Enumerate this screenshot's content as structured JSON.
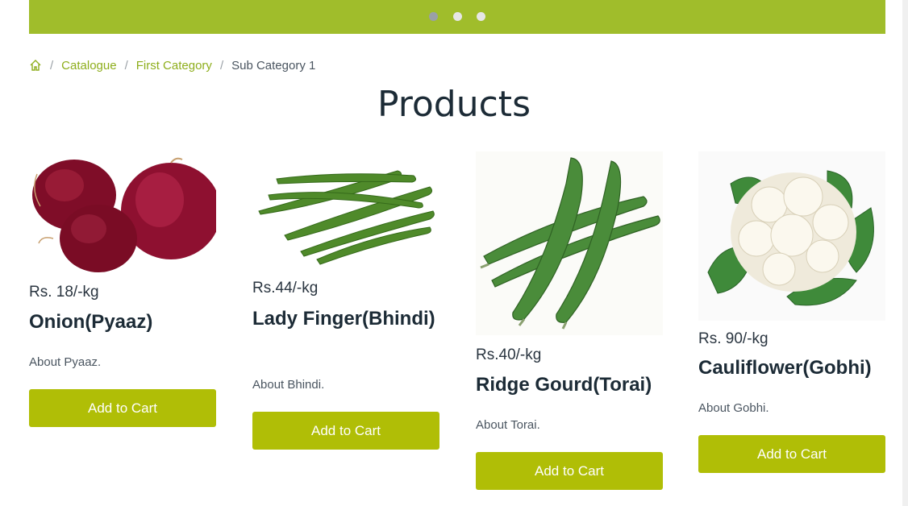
{
  "carousel": {
    "dots": [
      {
        "active": true
      },
      {
        "active": false
      },
      {
        "active": false
      }
    ]
  },
  "breadcrumb": {
    "home_icon": "home-icon",
    "separator": "/",
    "items": [
      "Catalogue",
      "First Category"
    ],
    "current": "Sub Category 1"
  },
  "page": {
    "title": "Products"
  },
  "colors": {
    "brand": "#a0bd2b",
    "button": "#b0be06",
    "link": "#8eae1c"
  },
  "products": [
    {
      "price": "Rs. 18/-kg",
      "name": "Onion(Pyaaz)",
      "about": "About Pyaaz.",
      "button": "Add to Cart"
    },
    {
      "price": "Rs.44/-kg",
      "name": "Lady Finger(Bhindi)",
      "about": "About Bhindi.",
      "button": "Add to Cart"
    },
    {
      "price": "Rs.40/-kg",
      "name": "Ridge Gourd(Torai)",
      "about": "About Torai.",
      "button": "Add to Cart"
    },
    {
      "price": "Rs. 90/-kg",
      "name": "Cauliflower(Gobhi)",
      "about": "About Gobhi.",
      "button": "Add to Cart"
    }
  ]
}
